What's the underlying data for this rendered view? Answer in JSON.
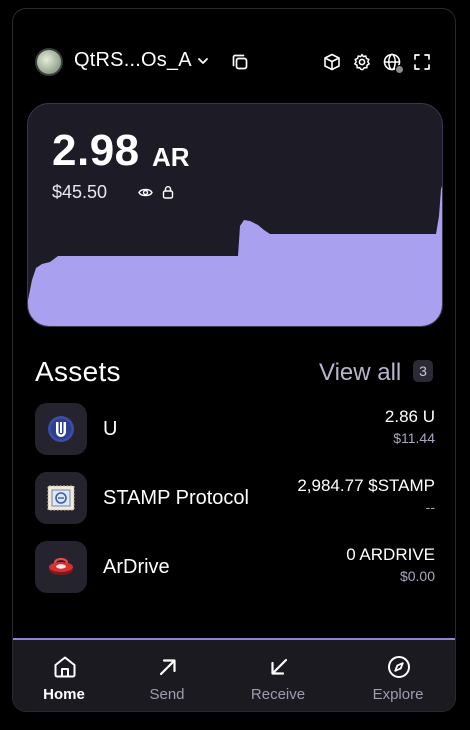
{
  "header": {
    "account_name": "QtRS...Os_A",
    "icons": [
      "avatar",
      "chevron-down-icon",
      "copy-icon",
      "cube-icon",
      "gear-icon",
      "globe-icon",
      "fullscreen-icon"
    ]
  },
  "balance": {
    "amount": "2.98",
    "unit": "AR",
    "fiat": "$45.50",
    "chart_color": "#a9a0f0"
  },
  "assets": {
    "title": "Assets",
    "view_all_label": "View all",
    "count": "3",
    "items": [
      {
        "name": "U",
        "quantity": "2.86 U",
        "fiat": "$11.44",
        "icon": "u-token-icon"
      },
      {
        "name": "STAMP Protocol",
        "quantity": "2,984.77 $STAMP",
        "fiat": "--",
        "icon": "stamp-token-icon"
      },
      {
        "name": "ArDrive",
        "quantity": "0 ARDRIVE",
        "fiat": "$0.00",
        "icon": "ardrive-token-icon"
      }
    ]
  },
  "nav": {
    "items": [
      {
        "label": "Home",
        "icon": "home-icon",
        "active": true
      },
      {
        "label": "Send",
        "icon": "arrow-up-right-icon",
        "active": false
      },
      {
        "label": "Receive",
        "icon": "arrow-down-left-icon",
        "active": false
      },
      {
        "label": "Explore",
        "icon": "compass-icon",
        "active": false
      }
    ]
  },
  "colors": {
    "accent": "#a9a0f0",
    "card_bg": "#1d1b26",
    "nav_bg": "#1b1a21"
  }
}
